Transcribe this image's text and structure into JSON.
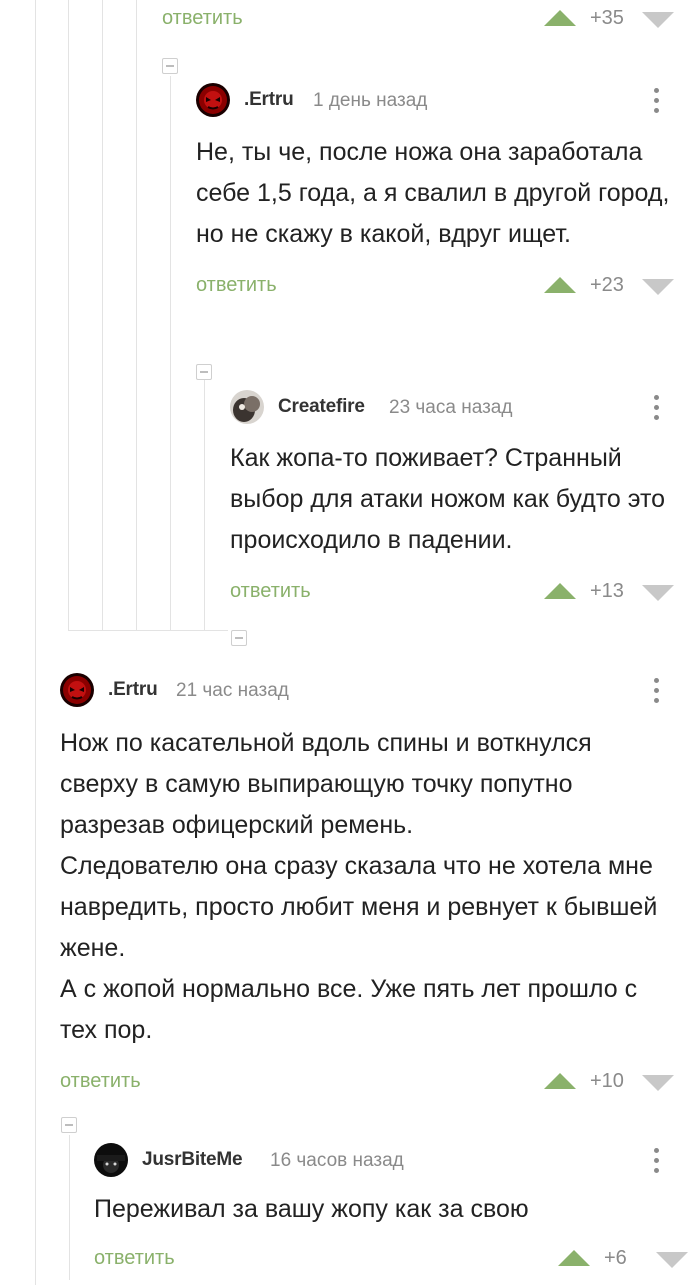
{
  "colors": {
    "reply": "#8ab16b",
    "vote_up": "#8ab16b",
    "vote_down": "#c8c8c8",
    "text": "#222222",
    "meta": "#8a8a8a",
    "thread_line": "#e3e3e3"
  },
  "icons": {
    "upvote": "triangle-up-icon",
    "downvote": "triangle-down-icon",
    "more": "vertical-dots-icon",
    "collapse": "minus-box-icon"
  },
  "top_footer": {
    "reply_label": "ответить",
    "rating": "+35"
  },
  "comments": [
    {
      "username": ".Ertru",
      "time": "1 день назад",
      "text_lines": [
        "Не, ты че, после ножа она заработала себе 1,5 года, а я свалил в другой город, но не скажу в какой, вдруг ищет."
      ],
      "reply_label": "ответить",
      "rating": "+23"
    },
    {
      "username": "Createfire",
      "time": "23 часа назад",
      "text_lines": [
        "Как жопа-то поживает? Странный выбор для атаки ножом как будто это происходило в падении."
      ],
      "reply_label": "ответить",
      "rating": "+13"
    },
    {
      "username": ".Ertru",
      "time": "21 час назад",
      "text_lines": [
        "Нож по касательной вдоль спины и воткнулся сверху в самую выпирающую точку попутно разрезав офицерский ремень.",
        "Следователю она сразу сказала что не хотела мне навредить, просто любит меня и ревнует к бывшей жене.",
        "А с жопой нормально все. Уже пять лет прошло с тех пор."
      ],
      "reply_label": "ответить",
      "rating": "+10"
    },
    {
      "username": "JusrBiteMe",
      "time": "16 часов назад",
      "text_lines": [
        "Переживал за вашу жопу как за свою"
      ],
      "reply_label": "ответить",
      "rating": "+6"
    }
  ]
}
